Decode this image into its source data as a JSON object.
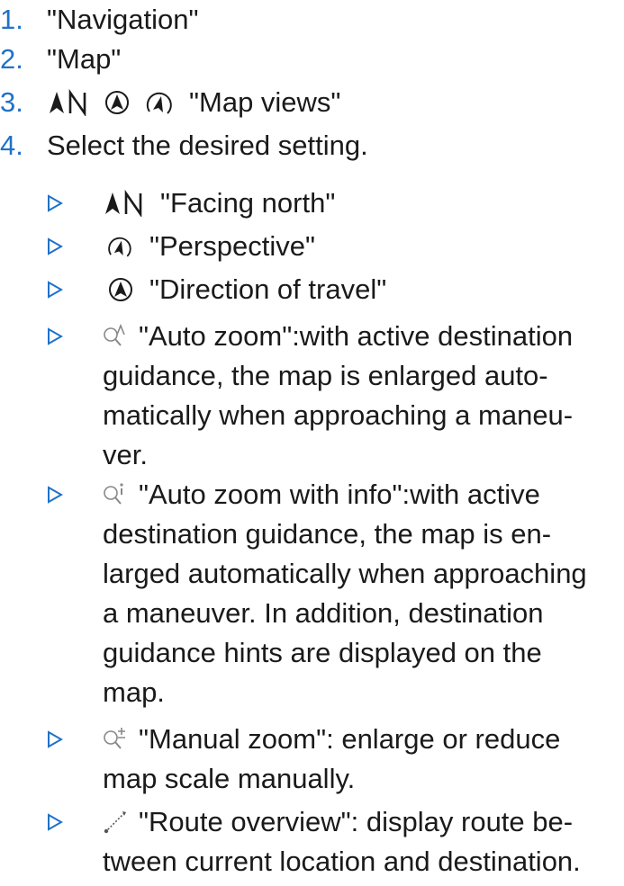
{
  "steps": [
    {
      "num": "1.",
      "text": "\"Navigation\""
    },
    {
      "num": "2.",
      "text": "\"Map\""
    },
    {
      "num": "3.",
      "text": "\"Map views\"",
      "icons": [
        "facing-north-icon",
        "direction-of-travel-icon",
        "perspective-icon"
      ]
    },
    {
      "num": "4.",
      "text": "Select the desired setting."
    }
  ],
  "options": [
    {
      "icon": "facing-north-icon",
      "lines": [
        "\"Facing north\""
      ]
    },
    {
      "icon": "perspective-icon",
      "lines": [
        "\"Perspective\""
      ]
    },
    {
      "icon": "direction-of-travel-icon",
      "lines": [
        "\"Direction of travel\""
      ]
    },
    {
      "icon": "auto-zoom-icon",
      "lines": [
        "\"Auto zoom\":with active destination",
        "guidance, the map is enlarged auto-",
        "matically when approaching a maneu-",
        "ver."
      ]
    },
    {
      "icon": "auto-zoom-info-icon",
      "lines": [
        "\"Auto zoom with info\":with active",
        "destination guidance, the map is en-",
        "larged automatically when approaching",
        "a maneuver. In addition, destination",
        "guidance hints are displayed on the",
        "map."
      ]
    },
    {
      "icon": "manual-zoom-icon",
      "lines": [
        "\"Manual zoom\": enlarge or reduce",
        "map scale manually."
      ]
    },
    {
      "icon": "route-overview-icon",
      "lines": [
        "\"Route overview\": display route be-",
        "tween current location and destination."
      ]
    }
  ],
  "colors": {
    "step_number": "#1f72c8",
    "bullet_marker": "#1f72c8",
    "text": "#1a1a1a"
  }
}
